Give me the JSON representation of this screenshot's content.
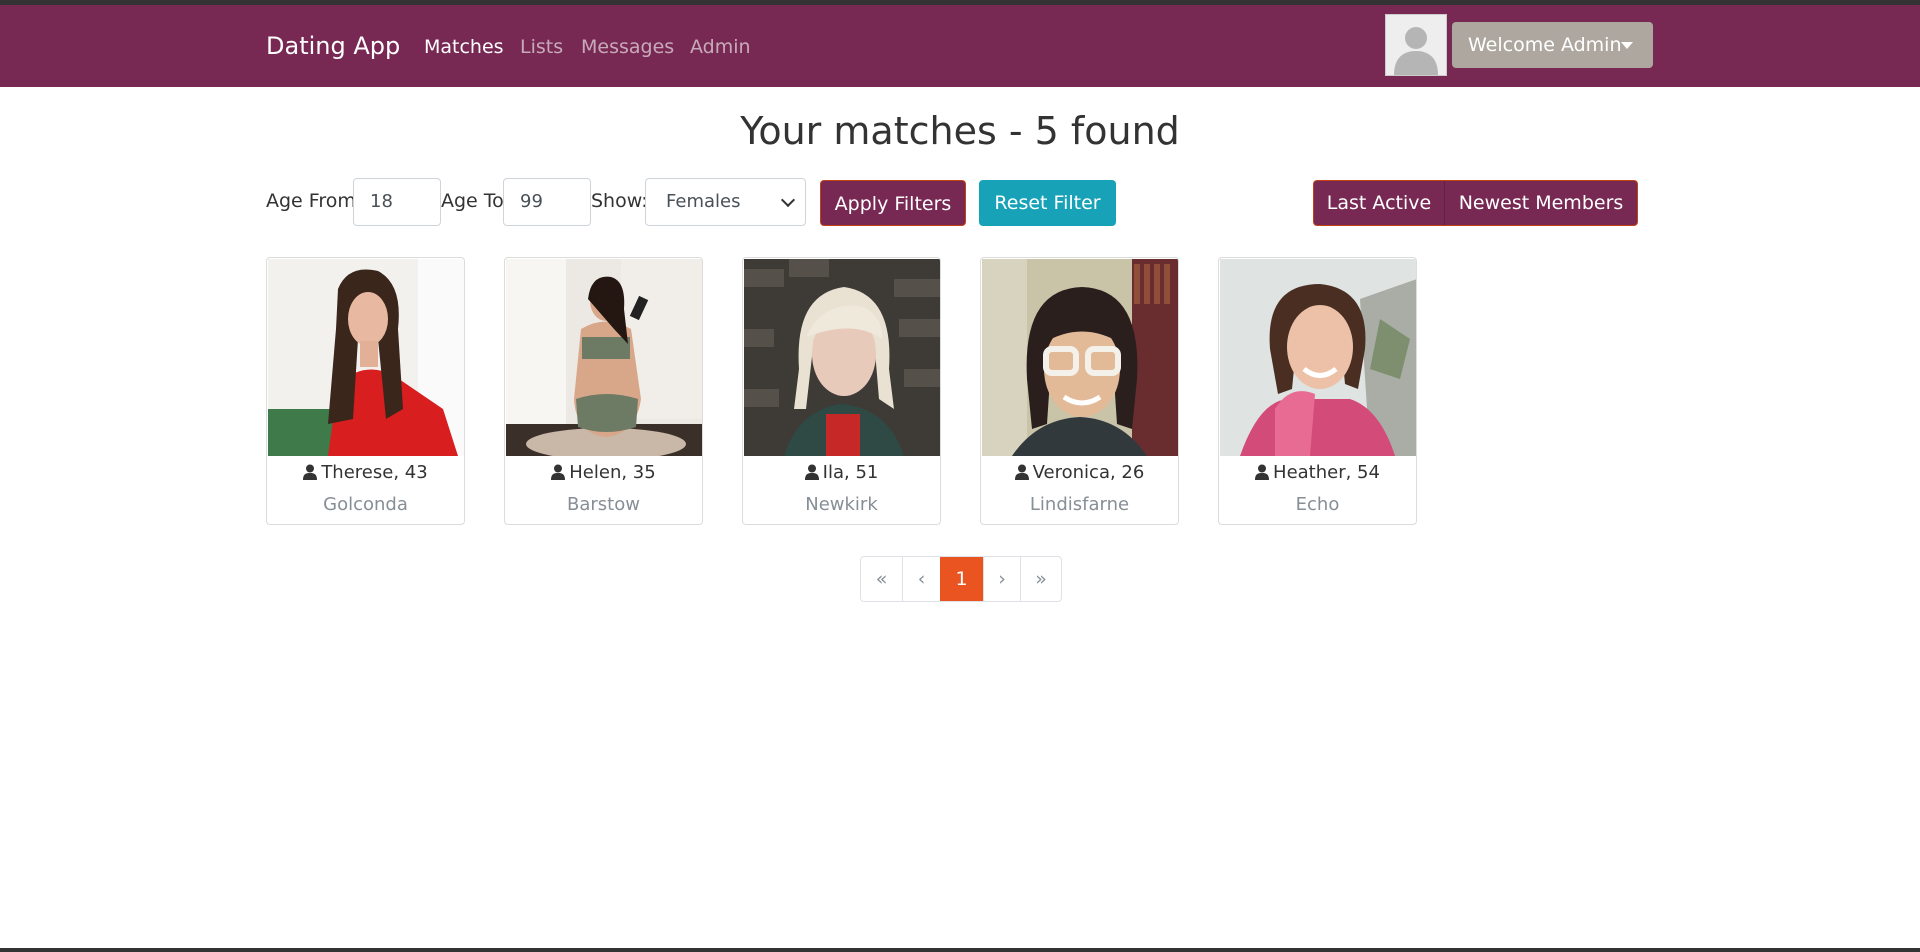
{
  "nav": {
    "brand": "Dating App",
    "links": [
      {
        "label": "Matches",
        "active": true
      },
      {
        "label": "Lists",
        "active": false
      },
      {
        "label": "Messages",
        "active": false
      },
      {
        "label": "Admin",
        "active": false
      }
    ],
    "welcome": "Welcome Admin",
    "avatar_icon": "user-avatar-placeholder-icon"
  },
  "page": {
    "title": "Your matches - 5 found"
  },
  "filters": {
    "age_from_label": "Age From",
    "age_from_value": "18",
    "age_to_label": "Age To",
    "age_to_value": "99",
    "show_label": "Show:",
    "show_value": "Females",
    "apply_label": "Apply Filters",
    "reset_label": "Reset Filter"
  },
  "sort": {
    "last_active": "Last Active",
    "newest": "Newest Members"
  },
  "members": [
    {
      "name": "Therese, 43",
      "city": "Golconda"
    },
    {
      "name": "Helen, 35",
      "city": "Barstow"
    },
    {
      "name": "Ila, 51",
      "city": "Newkirk"
    },
    {
      "name": "Veronica, 26",
      "city": "Lindisfarne"
    },
    {
      "name": "Heather, 54",
      "city": "Echo"
    }
  ],
  "pagination": {
    "first": "«",
    "prev": "‹",
    "current": "1",
    "next": "›",
    "last": "»"
  },
  "colors": {
    "navbar": "#772953",
    "primary_button": "#772953",
    "info_button": "#17a2b8",
    "active_page": "#e95420",
    "welcome_button": "#aea79f"
  }
}
